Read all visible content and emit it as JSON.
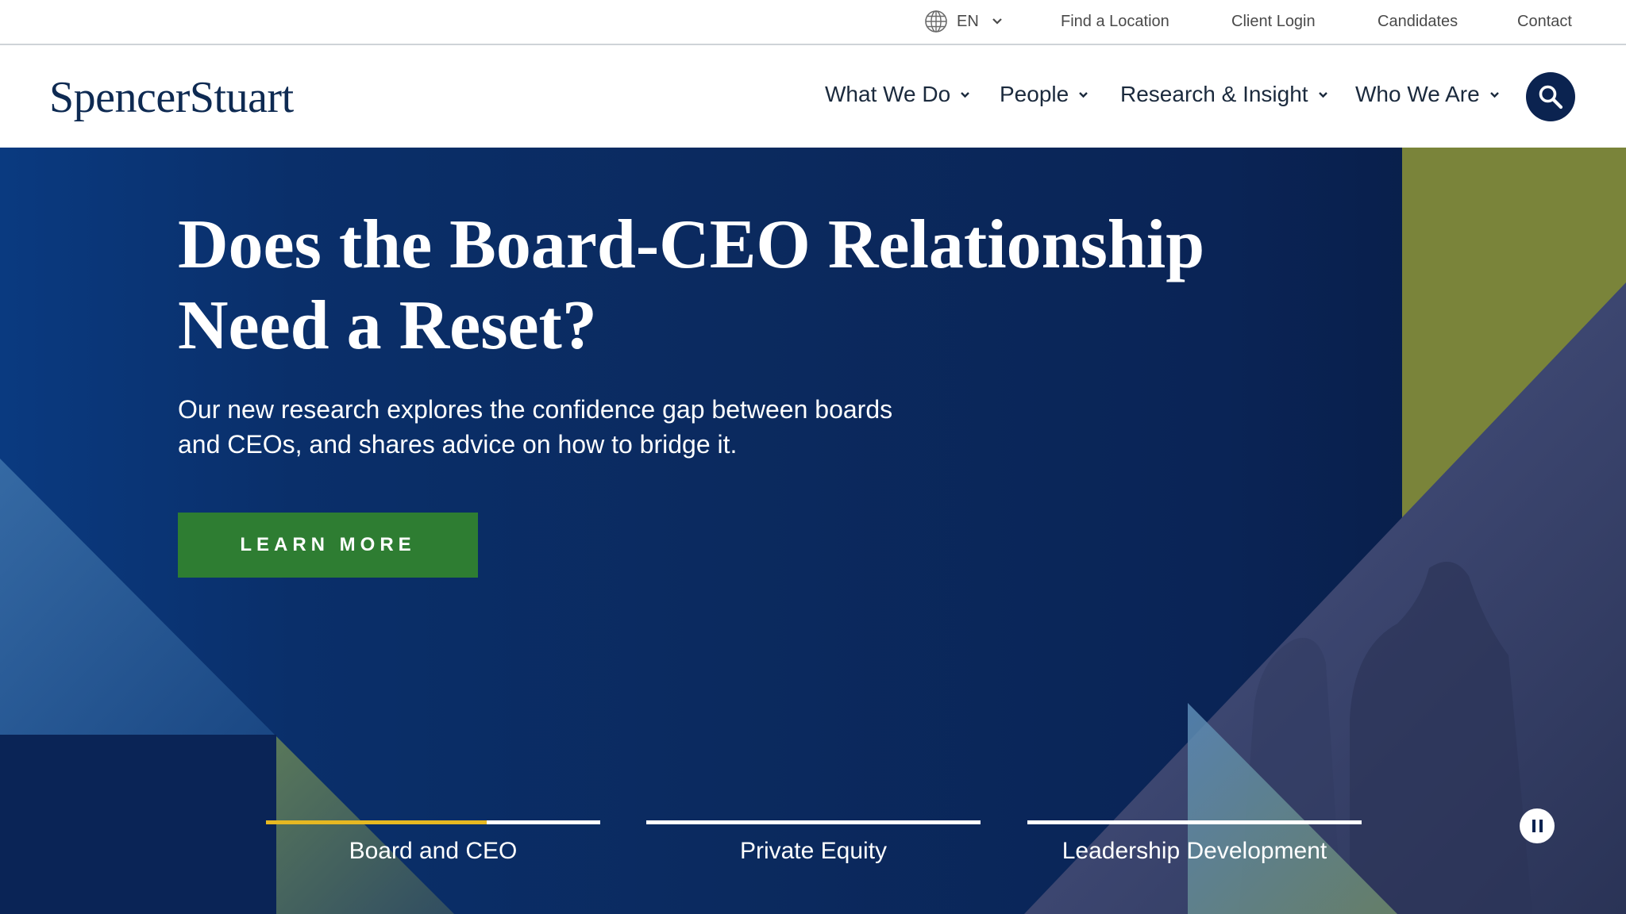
{
  "utility": {
    "language": "EN",
    "links": [
      "Find a Location",
      "Client Login",
      "Candidates",
      "Contact"
    ]
  },
  "header": {
    "logo": "SpencerStuart",
    "nav": [
      "What We Do",
      "People",
      "Research & Insight",
      "Who We Are"
    ]
  },
  "hero": {
    "title_line1": "Does the Board-CEO Relationship",
    "title_line2": "Need a Reset?",
    "subtitle_line1": "Our new research explores the confidence gap between boards",
    "subtitle_line2": "and CEOs, and shares advice on how to bridge it.",
    "cta_label": "LEARN MORE",
    "tabs": [
      {
        "label": "Board and CEO",
        "progress": 0.66
      },
      {
        "label": "Private Equity",
        "progress": 0
      },
      {
        "label": "Leadership Development",
        "progress": 0
      }
    ]
  },
  "icons": [
    "globe-icon",
    "chevron-down-icon",
    "search-icon",
    "pause-icon"
  ],
  "colors": {
    "brand_navy": "#0b2350",
    "hero_blue": "#0a2a5e",
    "cta_green": "#2e7d32",
    "accent_olive": "#7a843a",
    "progress_yellow": "#e6b822"
  }
}
